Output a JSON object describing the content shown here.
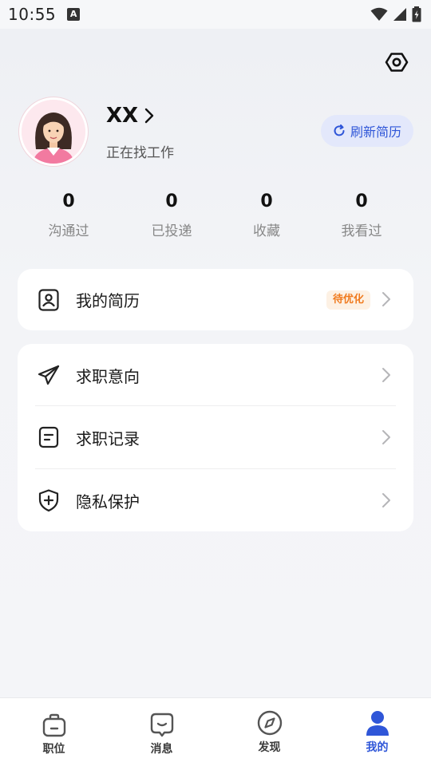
{
  "status_bar": {
    "time": "10:55",
    "a_badge": "A"
  },
  "profile": {
    "name": "XX",
    "status": "正在找工作",
    "refresh_label": "刷新简历"
  },
  "stats": [
    {
      "value": "0",
      "label": "沟通过"
    },
    {
      "value": "0",
      "label": "已投递"
    },
    {
      "value": "0",
      "label": "收藏"
    },
    {
      "value": "0",
      "label": "我看过"
    }
  ],
  "resume_card": {
    "label": "我的简历",
    "badge": "待优化"
  },
  "menu": [
    {
      "label": "求职意向",
      "icon": "send-icon"
    },
    {
      "label": "求职记录",
      "icon": "record-icon"
    },
    {
      "label": "隐私保护",
      "icon": "shield-icon"
    }
  ],
  "tabs": [
    {
      "label": "职位",
      "icon": "briefcase-icon",
      "active": false
    },
    {
      "label": "消息",
      "icon": "message-icon",
      "active": false
    },
    {
      "label": "发现",
      "icon": "compass-icon",
      "active": false
    },
    {
      "label": "我的",
      "icon": "person-icon",
      "active": true
    }
  ],
  "colors": {
    "accent": "#2f56d8",
    "accent_bg": "#e3e8fb",
    "badge_text": "#f07a1e",
    "badge_bg": "#fdf1e4",
    "page_bg": "#f3f4f7"
  }
}
